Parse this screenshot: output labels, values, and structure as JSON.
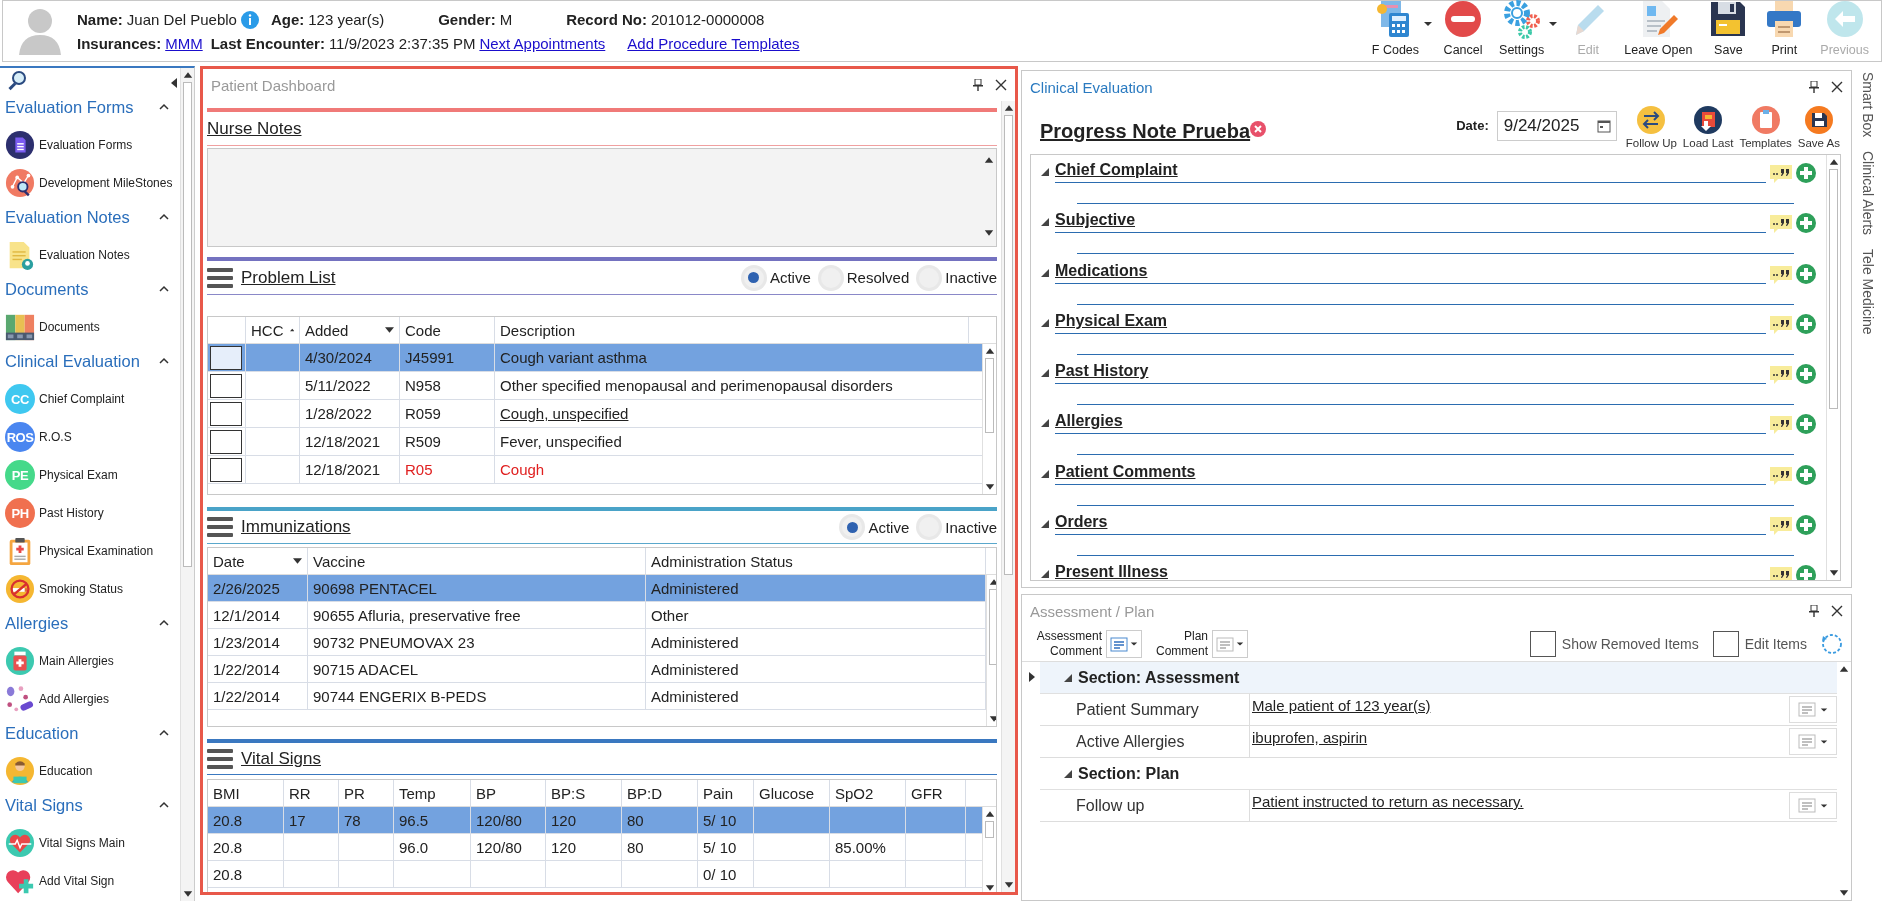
{
  "header": {
    "name_label": "Name:",
    "name": "Juan Del Pueblo",
    "age_label": "Age:",
    "age": "123 year(s)",
    "gender_label": "Gender:",
    "gender": "M",
    "record_label": "Record No:",
    "record": "201012-0000008",
    "insurances_label": "Insurances:",
    "insurance": "MMM",
    "last_encounter_label": "Last Encounter:",
    "last_encounter": "11/9/2023 2:37:35 PM",
    "links": [
      "Next Appointments",
      "Add Procedure Templates"
    ]
  },
  "toolbar": [
    {
      "label": "F Codes",
      "kind": "calculator",
      "menu": true,
      "disabled": false
    },
    {
      "label": "Cancel",
      "kind": "cancel",
      "menu": false,
      "disabled": false
    },
    {
      "label": "Settings",
      "kind": "gears",
      "menu": true,
      "disabled": false
    },
    {
      "label": "Edit",
      "kind": "pencil",
      "menu": false,
      "disabled": true
    },
    {
      "label": "Leave Open",
      "kind": "docpencil",
      "menu": false,
      "disabled": false
    },
    {
      "label": "Save",
      "kind": "floppy",
      "menu": false,
      "disabled": false
    },
    {
      "label": "Print",
      "kind": "printer",
      "menu": false,
      "disabled": false
    },
    {
      "label": "Previous",
      "kind": "back",
      "menu": false,
      "disabled": true
    }
  ],
  "sidebar": {
    "groups": [
      {
        "title": "Evaluation Forms",
        "expanded": true,
        "items": [
          {
            "label": "Evaluation Forms",
            "kind": "forms"
          },
          {
            "label": "Development MileStones",
            "kind": "milestones"
          }
        ]
      },
      {
        "title": "Evaluation Notes",
        "expanded": true,
        "items": [
          {
            "label": "Evaluation Notes",
            "kind": "note"
          }
        ]
      },
      {
        "title": "Documents",
        "expanded": true,
        "items": [
          {
            "label": "Documents",
            "kind": "folders"
          }
        ]
      },
      {
        "title": "Clinical Evaluation",
        "expanded": true,
        "items": [
          {
            "label": "Chief Complaint",
            "kind": "badge",
            "badge": "CC",
            "color": "#3fc8f0"
          },
          {
            "label": "R.O.S",
            "kind": "badge",
            "badge": "ROS",
            "color": "#4a86f0"
          },
          {
            "label": "Physical Exam",
            "kind": "badge",
            "badge": "PE",
            "color": "#45d98a"
          },
          {
            "label": "Past History",
            "kind": "badge",
            "badge": "PH",
            "color": "#f0704f"
          },
          {
            "label": "Physical Examination",
            "kind": "clipboard"
          },
          {
            "label": "Smoking Status",
            "kind": "nosmoking"
          }
        ]
      },
      {
        "title": "Allergies",
        "expanded": true,
        "items": [
          {
            "label": "Main Allergies",
            "kind": "bottle"
          },
          {
            "label": "Add Allergies",
            "kind": "pills"
          }
        ]
      },
      {
        "title": "Education",
        "expanded": true,
        "items": [
          {
            "label": "Education",
            "kind": "person"
          }
        ]
      },
      {
        "title": "Vital Signs",
        "expanded": true,
        "items": [
          {
            "label": "Vital Signs Main",
            "kind": "heartline"
          },
          {
            "label": "Add Vital Sign",
            "kind": "heartplus"
          }
        ]
      }
    ]
  },
  "dashboard": {
    "title": "Patient Dashboard",
    "nurse_notes": {
      "title": "Nurse Notes"
    },
    "problem_list": {
      "title": "Problem List",
      "filters": [
        {
          "label": "Active",
          "selected": true
        },
        {
          "label": "Resolved",
          "selected": false
        },
        {
          "label": "Inactive",
          "selected": false
        }
      ],
      "columns": [
        {
          "label": "HCC",
          "kind": "ascending"
        },
        {
          "label": "Added",
          "kind": "descending"
        },
        {
          "label": "Code",
          "kind": "plain"
        },
        {
          "label": "Description",
          "kind": "plain"
        }
      ],
      "rows": [
        {
          "added": "4/30/2024",
          "code": "J45991",
          "description": "Cough variant asthma",
          "selected": true,
          "checked": false,
          "kind": "plain"
        },
        {
          "added": "5/11/2022",
          "code": "N958",
          "description": "Other specified menopausal and perimenopausal disorders",
          "selected": false,
          "checked": false,
          "kind": "plain"
        },
        {
          "added": "1/28/2022",
          "code": "R059",
          "description": "Cough, unspecified",
          "selected": false,
          "checked": false,
          "kind": "linked"
        },
        {
          "added": "12/18/2021",
          "code": "R509",
          "description": "Fever, unspecified",
          "selected": false,
          "checked": false,
          "kind": "plain"
        },
        {
          "added": "12/18/2021",
          "code": "R05",
          "description": "Cough",
          "selected": false,
          "checked": false,
          "kind": "alert"
        }
      ]
    },
    "immunizations": {
      "title": "Immunizations",
      "filters": [
        {
          "label": "Active",
          "selected": true
        },
        {
          "label": "Inactive",
          "selected": false
        }
      ],
      "columns": [
        {
          "label": "Date",
          "kind": "descending"
        },
        {
          "label": "Vaccine",
          "kind": "plain"
        },
        {
          "label": "Administration Status",
          "kind": "plain"
        }
      ],
      "rows": [
        {
          "date": "2/26/2025",
          "vaccine": "90698 PENTACEL",
          "status": "Administered",
          "selected": true
        },
        {
          "date": "12/1/2014",
          "vaccine": "90655 Afluria, preservative free",
          "status": "Other",
          "selected": false
        },
        {
          "date": "1/23/2014",
          "vaccine": "90732 PNEUMOVAX 23",
          "status": "Administered",
          "selected": false
        },
        {
          "date": "1/22/2014",
          "vaccine": "90715 ADACEL",
          "status": "Administered",
          "selected": false
        },
        {
          "date": "1/22/2014",
          "vaccine": "90744 ENGERIX B-PEDS",
          "status": "Administered",
          "selected": false
        }
      ]
    },
    "vital_signs": {
      "title": "Vital Signs",
      "columns": [
        "BMI",
        "RR",
        "PR",
        "Temp",
        "BP",
        "BP:S",
        "BP:D",
        "Pain",
        "Glucose",
        "SpO2",
        "GFR"
      ],
      "rows": [
        {
          "cells": [
            "20.8",
            "17",
            "78",
            "96.5",
            "120/80",
            "120",
            "80",
            "5/ 10",
            null,
            null,
            null
          ],
          "selected": true
        },
        {
          "cells": [
            "20.8",
            null,
            null,
            "96.0",
            "120/80",
            "120",
            "80",
            "5/ 10",
            null,
            "85.00%",
            null
          ],
          "selected": false
        },
        {
          "cells": [
            "20.8",
            null,
            null,
            null,
            null,
            null,
            null,
            "0/ 10",
            null,
            null,
            null
          ],
          "selected": false
        }
      ]
    }
  },
  "clinical_evaluation": {
    "title": "Clinical Evaluation",
    "note_title": "Progress Note Prueba",
    "date_label": "Date:",
    "date": "9/24/2025",
    "actions": [
      {
        "label": "Follow Up",
        "kind": "swap"
      },
      {
        "label": "Load Last",
        "kind": "load"
      },
      {
        "label": "Templates",
        "kind": "templates"
      },
      {
        "label": "Save As",
        "kind": "save"
      }
    ],
    "sections": [
      {
        "title": "Chief Complaint",
        "expanded": true
      },
      {
        "title": "Subjective",
        "expanded": true
      },
      {
        "title": "Medications",
        "expanded": true
      },
      {
        "title": "Physical Exam",
        "expanded": true
      },
      {
        "title": "Past History",
        "expanded": true
      },
      {
        "title": "Allergies",
        "expanded": true
      },
      {
        "title": "Patient Comments",
        "expanded": true
      },
      {
        "title": "Orders",
        "expanded": true
      },
      {
        "title": "Present Illness",
        "expanded": true
      }
    ]
  },
  "assessment_plan": {
    "title": "Assessment / Plan",
    "comment_pickers": [
      {
        "label": "Assessment Comment",
        "disabled": false
      },
      {
        "label": "Plan Comment",
        "disabled": true
      }
    ],
    "options": [
      {
        "label": "Show Removed Items",
        "checked": false
      },
      {
        "label": "Edit Items",
        "checked": false
      }
    ],
    "sections": [
      {
        "title": "Section: Assessment",
        "expanded": true,
        "current": true,
        "rows": [
          {
            "label": "Patient Summary",
            "value": "Male patient of 123 year(s)"
          },
          {
            "label": "Active Allergies",
            "value": "ibuprofen, aspirin"
          }
        ]
      },
      {
        "title": "Section: Plan",
        "expanded": true,
        "current": false,
        "rows": [
          {
            "label": "Follow up",
            "value": "Patient instructed to return as necessary."
          }
        ]
      }
    ]
  },
  "side_tabs": [
    "Smart Box",
    "Clinical Alerts",
    "Tele Medicine"
  ]
}
